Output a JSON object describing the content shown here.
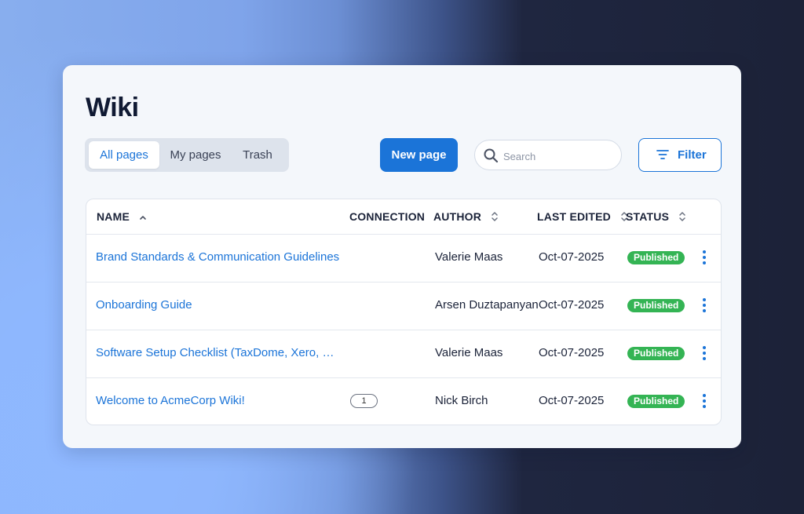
{
  "page": {
    "title": "Wiki"
  },
  "tabs": [
    {
      "label": "All pages",
      "active": true
    },
    {
      "label": "My pages",
      "active": false
    },
    {
      "label": "Trash",
      "active": false
    }
  ],
  "toolbar": {
    "new_page_label": "New page",
    "search_placeholder": "Search",
    "search_value": "",
    "filter_label": "Filter"
  },
  "table": {
    "columns": [
      "NAME",
      "CONNECTION",
      "AUTHOR",
      "LAST EDITED",
      "STATUS"
    ],
    "rows": [
      {
        "name": "Brand Standards & Communication Guidelines",
        "connection": "",
        "author": "Valerie Maas",
        "last_edited": "Oct-07-2025",
        "status": "Published"
      },
      {
        "name": "Onboarding Guide",
        "connection": "",
        "author": "Arsen Duztapanyan",
        "last_edited": "Oct-07-2025",
        "status": "Published"
      },
      {
        "name": "Software Setup Checklist (TaxDome, Xero, QBO,…",
        "connection": "",
        "author": "Valerie Maas",
        "last_edited": "Oct-07-2025",
        "status": "Published"
      },
      {
        "name": "Welcome to AcmeCorp Wiki!",
        "connection": "1",
        "author": "Nick Birch",
        "last_edited": "Oct-07-2025",
        "status": "Published"
      }
    ]
  },
  "icons": {
    "search": "search-icon",
    "filter": "filter-icon",
    "sort_asc": "sort-ascending-icon",
    "sort": "sort-icon",
    "row_menu": "more-vertical-icon"
  },
  "colors": {
    "accent": "#1b74d8",
    "status_published": "#34b454"
  }
}
